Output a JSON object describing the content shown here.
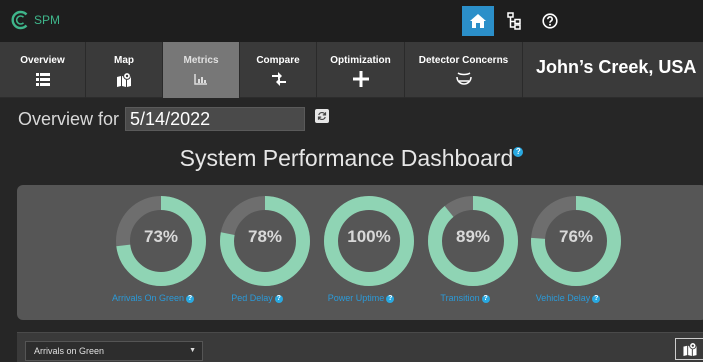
{
  "app": {
    "logo_text": "SPM"
  },
  "colors": {
    "accent": "#2f85c6",
    "gauge_fill": "#8fd4b4",
    "gauge_empty": "#6e6e6e",
    "link": "#2b9ad8"
  },
  "top_icons": [
    "home-icon",
    "hierarchy-icon",
    "help-icon"
  ],
  "tabs": [
    {
      "label": "Overview",
      "icon": "list-icon",
      "state": "active"
    },
    {
      "label": "Map",
      "icon": "map-marker-icon",
      "state": "normal"
    },
    {
      "label": "Metrics",
      "icon": "bar-chart-icon",
      "state": "selected"
    },
    {
      "label": "Compare",
      "icon": "arrows-icon",
      "state": "normal"
    },
    {
      "label": "Optimization",
      "icon": "crosshair-icon",
      "state": "normal"
    },
    {
      "label": "Detector Concerns",
      "icon": "detector-icon",
      "state": "normal"
    }
  ],
  "city": "John’s Creek, USA",
  "overview": {
    "prefix": "Overview for",
    "date": "5/14/2022"
  },
  "dashboard": {
    "title": "System Performance Dashboard"
  },
  "gauges": [
    {
      "name": "gauge-arrivals-on-green",
      "label": "Arrivals On Green",
      "percent": 73,
      "display": "73%"
    },
    {
      "name": "gauge-ped-delay",
      "label": "Ped Delay",
      "percent": 78,
      "display": "78%"
    },
    {
      "name": "gauge-power-uptime",
      "label": "Power Uptime",
      "percent": 100,
      "display": "100%"
    },
    {
      "name": "gauge-transition",
      "label": "Transition",
      "percent": 89,
      "display": "89%"
    },
    {
      "name": "gauge-vehicle-delay",
      "label": "Vehicle Delay",
      "percent": 76,
      "display": "76%"
    }
  ],
  "bottom": {
    "select_value": "Arrivals on Green"
  }
}
